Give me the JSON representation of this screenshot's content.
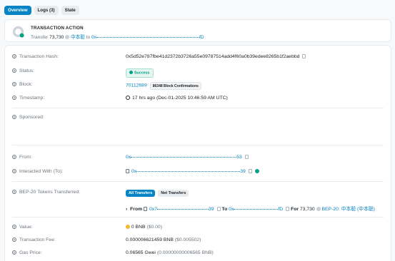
{
  "tabs": [
    {
      "label": "Overview",
      "active": true
    },
    {
      "label": "Logs (3)",
      "active": false
    },
    {
      "label": "State",
      "active": false
    }
  ],
  "transaction_action": {
    "title": "TRANSACTION ACTION",
    "verb": "Transfer",
    "amount": "73,730",
    "token": "中本聪",
    "to_word": "to",
    "to_address_start": "0x",
    "to_address_end": "fD"
  },
  "details": {
    "tx_hash_label": "Transaction Hash:",
    "tx_hash": "0x5d52e787fbe41d2372b3726a55e09787514add4f60a0b39edee8265b1f2aebbd",
    "status_label": "Status:",
    "status": "Success",
    "block_label": "Block:",
    "block": "70112689",
    "confirmations": "86348 Block Confirmations",
    "timestamp_label": "Timestamp:",
    "timestamp": "17 hrs ago (Dec-01-2025 10:46:59 AM UTC)",
    "sponsored_label": "Sponsored:",
    "from_label": "From:",
    "from_start": "0x",
    "from_end": "53",
    "interacted_label": "Interacted With (To):",
    "interacted_start": "0x",
    "interacted_end": "39",
    "bep20_label": "BEP-20 Tokens Transferred:",
    "transfer_tabs": [
      "All Transfers",
      "Net Transfers"
    ],
    "transfer": {
      "from_word": "From",
      "from_start": "0x7",
      "from_end": "39",
      "to_word": "To",
      "to_start": "0x",
      "to_end": "fD",
      "for_word": "For",
      "amount": "73,730",
      "token": "BEP-20: 中本聪 (中本聪)"
    },
    "value_label": "Value:",
    "value": "0 BNB",
    "value_usd": "($0.00)",
    "fee_label": "Transaction Fee:",
    "fee": "0.000006621459 BNB",
    "fee_usd": "($0.005502)",
    "gas_label": "Gas Price:",
    "gas": "0.06565 Gwei",
    "gas_bnb": "(0.00000000006565 BNB)"
  },
  "colors": {
    "accent": "#0784c3",
    "success": "#00a186",
    "token_yellow": "#f3ba2f"
  }
}
